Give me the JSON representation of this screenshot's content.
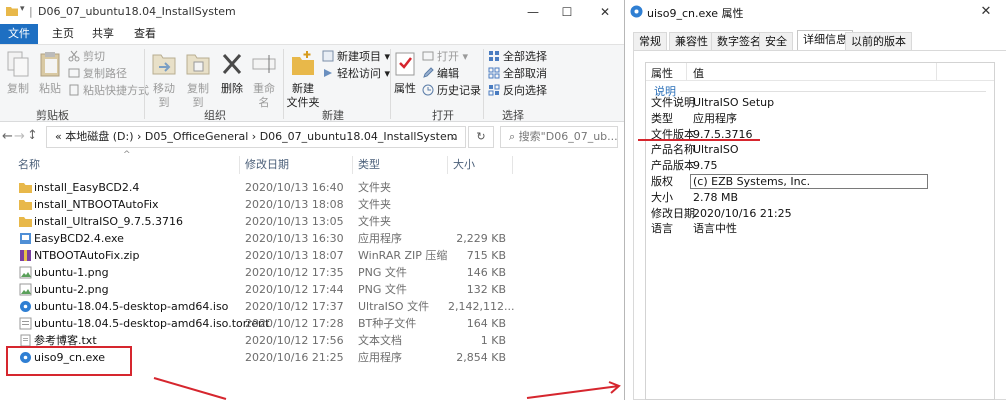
{
  "explorer": {
    "title": "D06_07_ubuntu18.04_InstallSystem",
    "window_buttons": {
      "minimize": "—",
      "maximize": "☐",
      "close": "✕"
    },
    "tabs": [
      "文件",
      "主页",
      "共享",
      "查看"
    ],
    "ribbon": {
      "clipboard": {
        "copy": "复制",
        "paste": "粘贴",
        "cut": "剪切",
        "copy_path": "复制路径",
        "paste_shortcut": "粘贴快捷方式",
        "label": "剪贴板"
      },
      "organize": {
        "move_to": "移动到",
        "copy_to": "复制到",
        "delete": "删除",
        "rename": "重命名",
        "label": "组织"
      },
      "new": {
        "new_folder_line1": "新建",
        "new_folder_line2": "文件夹",
        "new_item": "新建项目 ▾",
        "easy_access": "轻松访问 ▾",
        "label": "新建"
      },
      "open": {
        "properties": "属性",
        "open": "打开 ▾",
        "edit": "编辑",
        "history": "历史记录",
        "label": "打开"
      },
      "select": {
        "select_all": "全部选择",
        "select_none": "全部取消",
        "invert": "反向选择",
        "label": "选择"
      }
    },
    "address": {
      "path": "«  本地磁盘 (D:)  ›  D05_OfficeGeneral  ›  D06_07_ubuntu18.04_InstallSystem",
      "dropdown": "⌄",
      "refresh": "↻",
      "search_placeholder": "搜索\"D06_07_ub..."
    },
    "nav": {
      "back": "←",
      "forward": "→",
      "recent": "⌄",
      "up": "↑"
    },
    "columns": {
      "name": "名称",
      "date": "修改日期",
      "type": "类型",
      "size": "大小"
    },
    "files": [
      {
        "name": "install_EasyBCD2.4",
        "date": "2020/10/13 16:40",
        "type": "文件夹",
        "size": "",
        "icon": "folder-icon"
      },
      {
        "name": "install_NTBOOTAutoFix",
        "date": "2020/10/13 18:08",
        "type": "文件夹",
        "size": "",
        "icon": "folder-icon"
      },
      {
        "name": "install_UltraISO_9.7.5.3716",
        "date": "2020/10/13 13:05",
        "type": "文件夹",
        "size": "",
        "icon": "folder-icon"
      },
      {
        "name": "EasyBCD2.4.exe",
        "date": "2020/10/13 16:30",
        "type": "应用程序",
        "size": "2,229 KB",
        "icon": "exe-icon"
      },
      {
        "name": "NTBOOTAutoFix.zip",
        "date": "2020/10/13 18:07",
        "type": "WinRAR ZIP 压缩...",
        "size": "715 KB",
        "icon": "zip-icon"
      },
      {
        "name": "ubuntu-1.png",
        "date": "2020/10/12 17:35",
        "type": "PNG 文件",
        "size": "146 KB",
        "icon": "image-icon"
      },
      {
        "name": "ubuntu-2.png",
        "date": "2020/10/12 17:44",
        "type": "PNG 文件",
        "size": "132 KB",
        "icon": "image-icon"
      },
      {
        "name": "ubuntu-18.04.5-desktop-amd64.iso",
        "date": "2020/10/12 17:37",
        "type": "UltraISO 文件",
        "size": "2,142,112...",
        "icon": "iso-icon"
      },
      {
        "name": "ubuntu-18.04.5-desktop-amd64.iso.torrent",
        "date": "2020/10/12 17:28",
        "type": "BT种子文件",
        "size": "164 KB",
        "icon": "torrent-icon"
      },
      {
        "name": "参考博客.txt",
        "date": "2020/10/12 17:56",
        "type": "文本文档",
        "size": "1 KB",
        "icon": "text-file-icon"
      },
      {
        "name": "uiso9_cn.exe",
        "date": "2020/10/16 21:25",
        "type": "应用程序",
        "size": "2,854 KB",
        "icon": "ultraiso-icon"
      }
    ]
  },
  "properties": {
    "title": "uiso9_cn.exe 属性",
    "close": "✕",
    "tabs": [
      "常规",
      "兼容性",
      "数字签名",
      "安全",
      "详细信息",
      "以前的版本"
    ],
    "active_tab": "详细信息",
    "header": {
      "property": "属性",
      "value": "值"
    },
    "section": "说明",
    "rows": [
      {
        "key": "文件说明",
        "value": "UltraISO Setup"
      },
      {
        "key": "类型",
        "value": "应用程序"
      },
      {
        "key": "文件版本",
        "value": "9.7.5.3716"
      },
      {
        "key": "产品名称",
        "value": "UltraISO"
      },
      {
        "key": "产品版本",
        "value": "9.75"
      },
      {
        "key": "版权",
        "value": "(c) EZB Systems, Inc."
      },
      {
        "key": "大小",
        "value": "2.78 MB"
      },
      {
        "key": "修改日期",
        "value": "2020/10/16 21:25"
      },
      {
        "key": "语言",
        "value": "语言中性"
      }
    ]
  },
  "colors": {
    "accent": "#1e6fc2",
    "annotation_red": "#d6262e",
    "section_blue": "#2a6fb8"
  }
}
